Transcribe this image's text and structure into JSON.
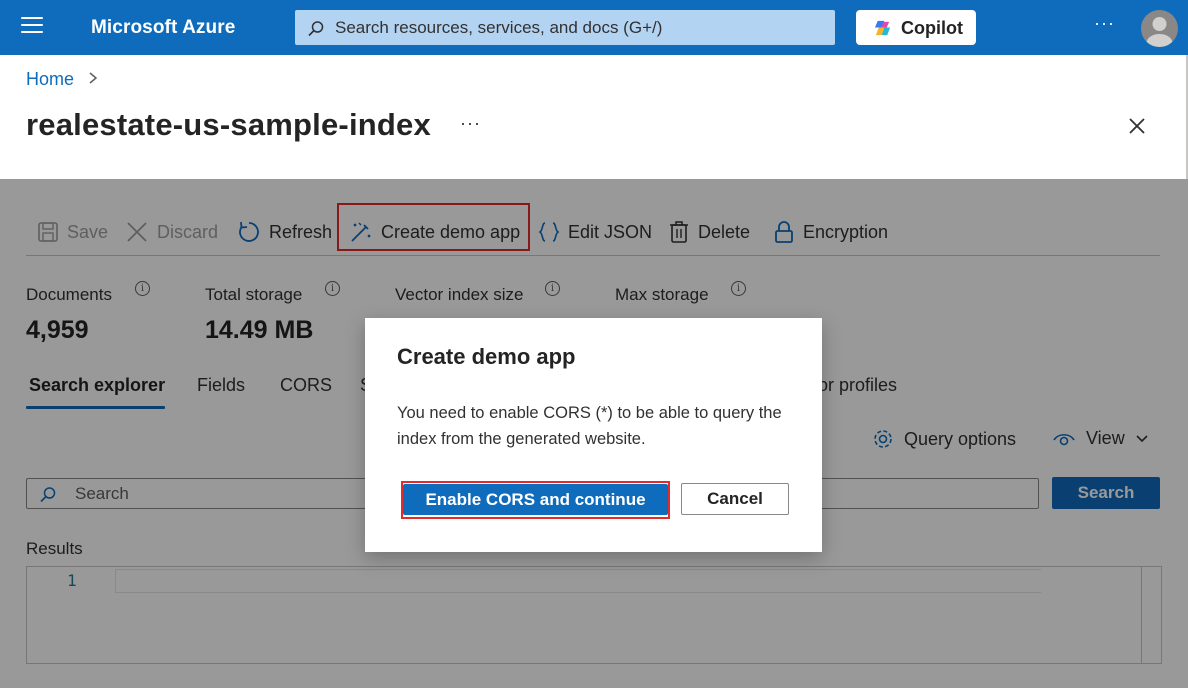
{
  "topbar": {
    "brand": "Microsoft Azure",
    "search_placeholder": "Search resources, services, and docs (G+/)",
    "copilot_label": "Copilot",
    "more_label": "···"
  },
  "breadcrumb": {
    "home": "Home",
    "separator": ">"
  },
  "page": {
    "title": "realestate-us-sample-index",
    "more_label": "···"
  },
  "toolbar": {
    "save": "Save",
    "discard": "Discard",
    "refresh": "Refresh",
    "create_demo_app": "Create demo app",
    "edit_json": "Edit JSON",
    "delete": "Delete",
    "encryption": "Encryption"
  },
  "stats": [
    {
      "label": "Documents",
      "value": "4,959"
    },
    {
      "label": "Total storage",
      "value": "14.49 MB"
    },
    {
      "label": "Vector index size",
      "value": ""
    },
    {
      "label": "Max storage",
      "value": ""
    }
  ],
  "tabs": [
    {
      "label": "Search explorer",
      "active": true
    },
    {
      "label": "Fields"
    },
    {
      "label": "CORS"
    },
    {
      "label": "S"
    },
    {
      "label": "or profiles"
    }
  ],
  "query": {
    "options_label": "Query options",
    "view_label": "View"
  },
  "search": {
    "placeholder": "Search",
    "button_label": "Search"
  },
  "results": {
    "label": "Results",
    "line_number": "1"
  },
  "dialog": {
    "title": "Create demo app",
    "body": "You need to enable CORS (*) to be able to query the index from the generated website.",
    "primary": "Enable CORS and continue",
    "secondary": "Cancel"
  },
  "colors": {
    "brand_blue": "#0f6cbd",
    "highlight_red": "#e32b2b"
  },
  "icons": [
    "hamburger-icon",
    "search-icon",
    "copilot-icon",
    "avatar-icon",
    "chevron-right-icon",
    "close-icon",
    "save-icon",
    "discard-icon",
    "refresh-icon",
    "magic-wand-icon",
    "braces-icon",
    "trash-icon",
    "lock-icon",
    "info-icon",
    "gear-icon",
    "eye-icon",
    "chevron-down-icon"
  ]
}
